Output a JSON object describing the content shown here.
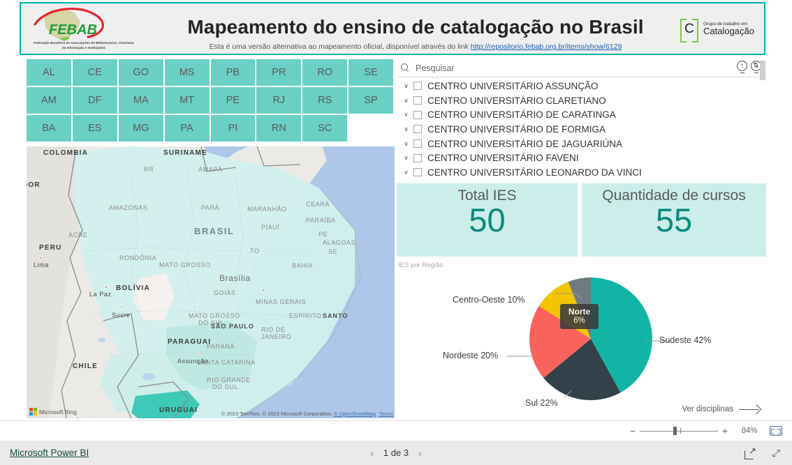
{
  "header": {
    "title": "Mapeamento do ensino de catalogação no Brasil",
    "subtitle_prefix": "Esta é uma versão alternativa ao mapeamento oficial, disponível através do link ",
    "subtitle_link": "http://repositorio.febab.org.br/items/show/6129",
    "left_logo_name": "FEBAB",
    "left_logo_caption": "Federação Brasileira de Associações de Bibliotecários, Cientistas da Informação e Instituições",
    "right_logo_letter": "C",
    "right_logo_line1": "Grupo de trabalho em",
    "right_logo_line2": "Catalogação"
  },
  "state_slicer": {
    "states": [
      "AL",
      "AM",
      "BA",
      "CE",
      "DF",
      "ES",
      "GO",
      "MA",
      "MG",
      "MS",
      "MT",
      "PA",
      "PB",
      "PE",
      "PI",
      "PR",
      "RJ",
      "RN",
      "RO",
      "RS",
      "SC",
      "SE",
      "SP"
    ],
    "button_color": "#6ad0c4",
    "text_color": "#5a5a5a"
  },
  "search": {
    "placeholder": "Pesquisar",
    "icon": "search-icon",
    "panel_icons": [
      "focus-mode-icon",
      "filter-sync-icon"
    ]
  },
  "institution_list": {
    "items": [
      "CENTRO UNIVERSITÁRIO ASSUNÇÃO",
      "CENTRO UNIVERSITÁRIO CLARETIANO",
      "CENTRO UNIVERSITÁRIO DE CARATINGA",
      "CENTRO UNIVERSITÁRIO DE FORMIGA",
      "CENTRO UNIVERSITÁRIO DE JAGUARIÚNA",
      "CENTRO UNIVERSITÁRIO FAVENI",
      "CENTRO UNIVERSITÁRIO LEONARDO DA VINCI"
    ]
  },
  "kpis": [
    {
      "title": "Total IES",
      "value": "50"
    },
    {
      "title": "Quantidade de cursos",
      "value": "55"
    }
  ],
  "pie_panel": {
    "footer_label": "Ver disciplinas",
    "highlight_label": "Norte",
    "highlight_value": "6%"
  },
  "chart_data": {
    "type": "pie",
    "title": "IES por Região",
    "categories": [
      "Sudeste",
      "Sul",
      "Nordeste",
      "Centro-Oeste",
      "Norte"
    ],
    "values": [
      42,
      22,
      20,
      10,
      6
    ],
    "labels": [
      "Sudeste 42%",
      "Sul 22%",
      "Nordeste 20%",
      "Centro-Oeste 10%",
      "Norte 6%"
    ],
    "colors": [
      "#12b5a5",
      "#33424a",
      "#f9635c",
      "#f2c500",
      "#6f7b7f"
    ],
    "unit": "%",
    "legend": "none",
    "datalabels": true
  },
  "map": {
    "provider": "Microsoft Bing",
    "attribution": "© 2023 TomTom, © 2023 Microsoft Corporation,",
    "attribution_link": "© OpenStreetMap",
    "terms": "Terms",
    "labels": [
      "COLOMBIA",
      "SURINAME",
      "RR",
      "AMAPÁ",
      "AMAZONAS",
      "PARÁ",
      "MARANHÃO",
      "CEARÁ",
      "ACRE",
      "RONDÔNIA",
      "PIAUÍ",
      "PARAÍBA",
      "PE",
      "ALAGOAS",
      "SE",
      "TO",
      "BAHIA",
      "MATO GROSSO",
      "BRASIL",
      "Brasília",
      "GOIÁS",
      "MINAS GERAIS",
      "ESPÍRITO SANTO",
      "MATO GROSSO DO SUL",
      "SÃO PAULO",
      "RIO DE JANEIRO",
      "PARANÁ",
      "SANTA CATARINA",
      "RIO GRANDE DO SUL",
      "PERU",
      "Lima",
      "BOLÍVIA",
      "La Paz",
      "Sucre",
      "PARAGUAI",
      "Assunção",
      "CHILE",
      "Santiago",
      "URUGUAI",
      "EQUADOR"
    ]
  },
  "zoom_bar": {
    "minus": "−",
    "plus": "+",
    "percent": "84%",
    "fit_icon": "fit-to-page-icon"
  },
  "footer": {
    "brand": "Microsoft Power BI",
    "page_indicator": "1 de 3",
    "prev_icon": "chevron-left-icon",
    "next_icon": "chevron-right-icon",
    "share_icon": "share-icon",
    "fullscreen_icon": "fullscreen-icon"
  }
}
